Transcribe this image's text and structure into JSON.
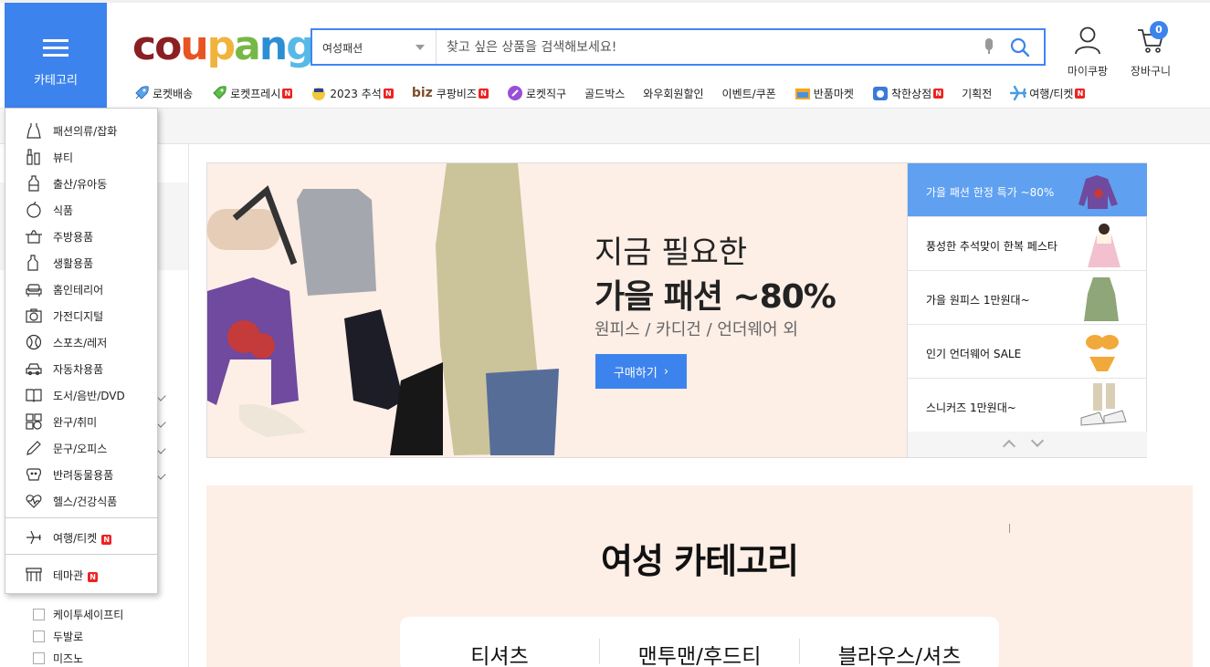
{
  "header": {
    "category_button": "카테고리",
    "logo_text": [
      "c",
      "o",
      "u",
      "p",
      "a",
      "n",
      "g"
    ],
    "search": {
      "selected_category": "여성패션",
      "placeholder": "찾고 싶은 상품을 검색해보세요!"
    },
    "my_coupang": "마이쿠팡",
    "cart": {
      "label": "장바구니",
      "count": "0"
    }
  },
  "nav": [
    {
      "label": "로켓배송",
      "icon": "rocket-icon",
      "new": false
    },
    {
      "label": "로켓프레시",
      "icon": "rocket-green-icon",
      "new": true
    },
    {
      "label": "2023 추석",
      "icon": "chuseok-icon",
      "new": true
    },
    {
      "label": "쿠팡비즈",
      "icon": "biz-icon",
      "new": true
    },
    {
      "label": "로켓직구",
      "icon": "global-rocket-icon",
      "new": false
    },
    {
      "label": "골드박스",
      "icon": "",
      "new": false
    },
    {
      "label": "와우회원할인",
      "icon": "",
      "new": false
    },
    {
      "label": "이벤트/쿠폰",
      "icon": "",
      "new": false
    },
    {
      "label": "반품마켓",
      "icon": "return-market-icon",
      "new": false
    },
    {
      "label": "착한상점",
      "icon": "good-store-icon",
      "new": true
    },
    {
      "label": "기획전",
      "icon": "",
      "new": false
    },
    {
      "label": "여행/티켓",
      "icon": "airplane-icon",
      "new": true
    }
  ],
  "nav_prefix_biz": "biz",
  "new_badge": "N",
  "category_menu": [
    {
      "label": "패션의류/잡화",
      "icon": "dress-icon"
    },
    {
      "label": "뷰티",
      "icon": "cosmetics-icon"
    },
    {
      "label": "출산/유아동",
      "icon": "baby-bottle-icon"
    },
    {
      "label": "식품",
      "icon": "apple-icon"
    },
    {
      "label": "주방용품",
      "icon": "pot-icon"
    },
    {
      "label": "생활용품",
      "icon": "detergent-icon"
    },
    {
      "label": "홈인테리어",
      "icon": "sofa-icon"
    },
    {
      "label": "가전디지털",
      "icon": "camera-icon"
    },
    {
      "label": "스포츠/레저",
      "icon": "ball-icon"
    },
    {
      "label": "자동차용품",
      "icon": "car-icon"
    },
    {
      "label": "도서/음반/DVD",
      "icon": "book-icon"
    },
    {
      "label": "완구/취미",
      "icon": "toy-icon"
    },
    {
      "label": "문구/오피스",
      "icon": "pencil-icon"
    },
    {
      "label": "반려동물용품",
      "icon": "dog-icon"
    },
    {
      "label": "헬스/건강식품",
      "icon": "heart-pulse-icon"
    }
  ],
  "category_menu_extra": [
    {
      "label": "여행/티켓",
      "icon": "airplane-icon",
      "new": true
    },
    {
      "label": "테마관",
      "icon": "storefront-icon",
      "new": true
    }
  ],
  "filter_brands": [
    "케이투세이프티",
    "두발로",
    "미즈노"
  ],
  "banner": {
    "title_line1": "지금 필요한",
    "title_line2": "가을 패션 ~80%",
    "subtitle": "원피스 / 카디건 / 언더웨어 외",
    "button": "구매하기",
    "side_items": [
      {
        "label": "가을 패션 한정 특가 ~80%",
        "active": true
      },
      {
        "label": "풍성한 추석맞이 한복 페스타",
        "active": false
      },
      {
        "label": "가을 원피스 1만원대~",
        "active": false
      },
      {
        "label": "인기 언더웨어 SALE",
        "active": false
      },
      {
        "label": "스니커즈 1만원대~",
        "active": false
      }
    ]
  },
  "women": {
    "title": "여성 카테고리",
    "categories": [
      "티셔츠",
      "맨투맨/후드티",
      "블라우스/셔츠"
    ]
  }
}
